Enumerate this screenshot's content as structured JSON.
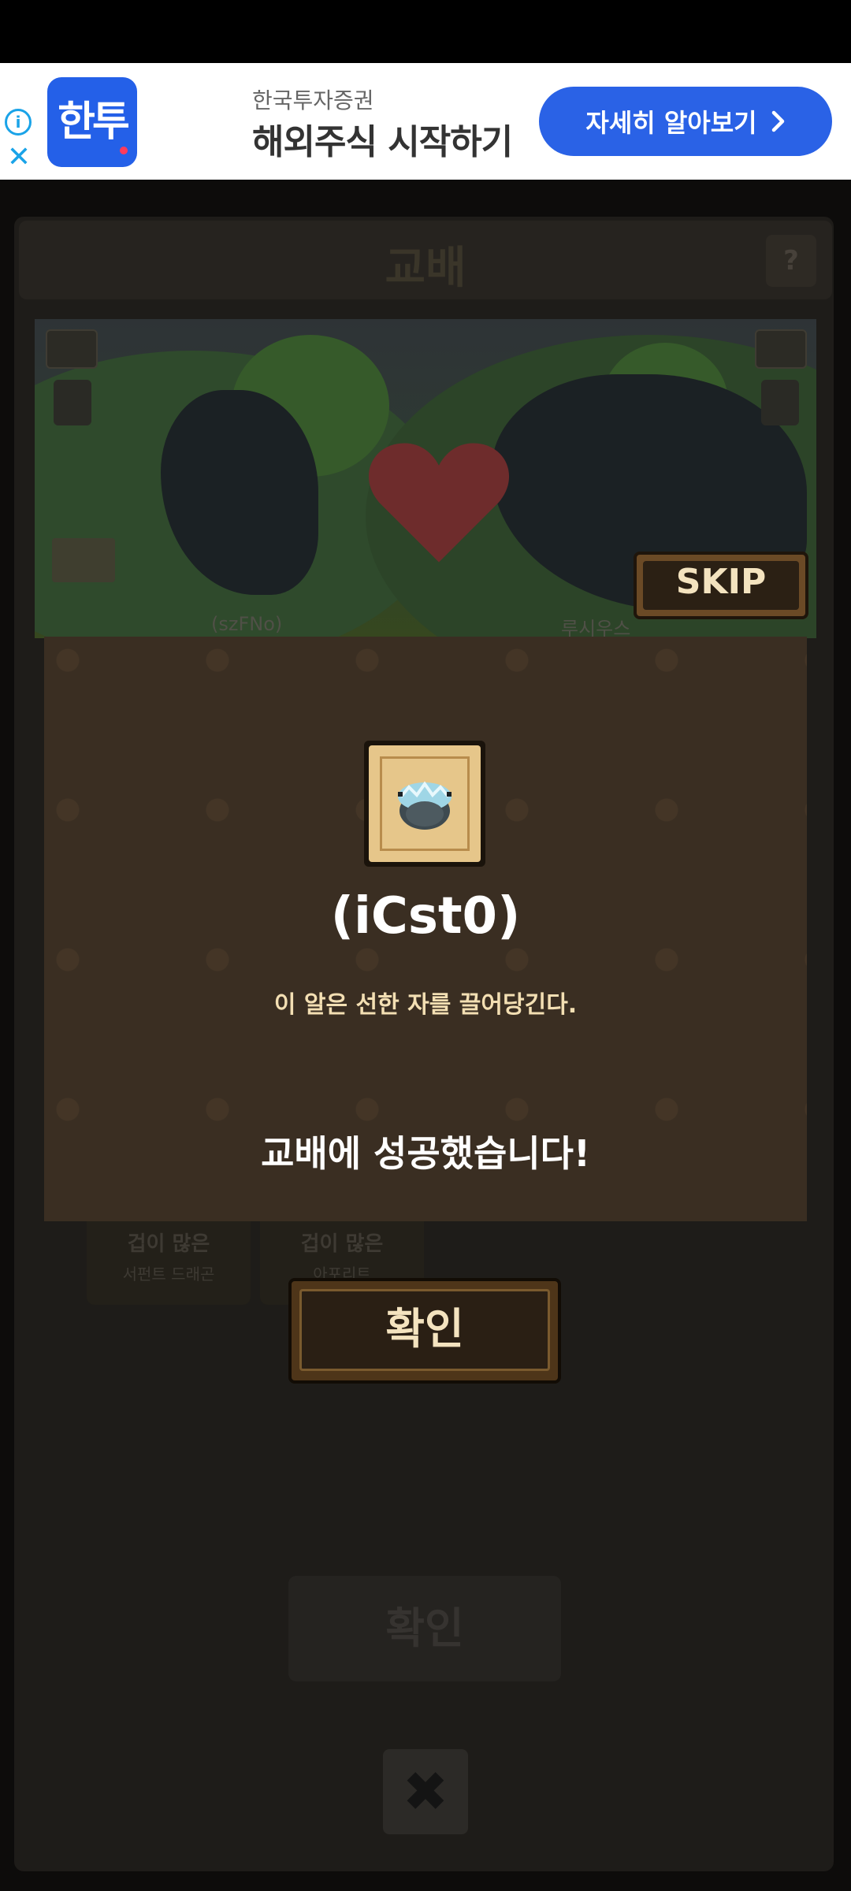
{
  "ad": {
    "logo_text": "한투",
    "brand": "한국투자증권",
    "headline": "해외주식 시작하기",
    "cta_label": "자세히 알아보기",
    "info_icon": "info-icon",
    "close_icon": "close-icon",
    "accent_color": "#2a62e6"
  },
  "background": {
    "title": "교배",
    "help_label": "?",
    "left_dragon_name": "(szFNo)",
    "right_dragon_name": "루시우스",
    "skip_label": "SKIP",
    "cards": [
      {
        "line1": "겁이 많은",
        "line2": "서펀트 드래곤"
      },
      {
        "line1": "겁이 많은",
        "line2": "아포리트"
      }
    ],
    "confirm_label": "확인",
    "close_label": "✖"
  },
  "result": {
    "item_icon": "egg-icon",
    "item_name": "(iCst0)",
    "item_description": "이 알은 선한 자를 끌어당긴다.",
    "message": "교배에 성공했습니다!",
    "confirm_label": "확인"
  }
}
